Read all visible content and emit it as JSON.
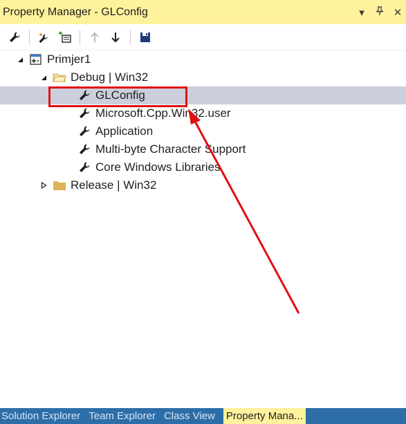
{
  "window": {
    "title": "Property Manager - GLConfig",
    "buttons": {
      "dropdown": "▾",
      "pin": "ꟷ",
      "close": "✕"
    }
  },
  "toolbar": {
    "items": [
      {
        "icon": "wrench-icon"
      },
      {
        "icon": "add-new-property-sheet-icon"
      },
      {
        "icon": "add-existing-property-sheet-icon"
      },
      {
        "icon": "move-up-icon"
      },
      {
        "icon": "move-down-icon"
      },
      {
        "icon": "save-icon"
      }
    ]
  },
  "tree": {
    "project": "Primjer1",
    "config_debug": "Debug | Win32",
    "config_release": "Release | Win32",
    "debug_sheets": [
      "GLConfig",
      "Microsoft.Cpp.Win32.user",
      "Application",
      "Multi-byte Character Support",
      "Core Windows Libraries"
    ]
  },
  "bottom_tabs": [
    "Solution Explorer",
    "Team Explorer",
    "Class View",
    "Property Mana..."
  ],
  "colors": {
    "title_bg": "#fff29d",
    "tab_bar": "#2d6ea8",
    "selection": "#cccedb",
    "annotation": "#e01010"
  }
}
